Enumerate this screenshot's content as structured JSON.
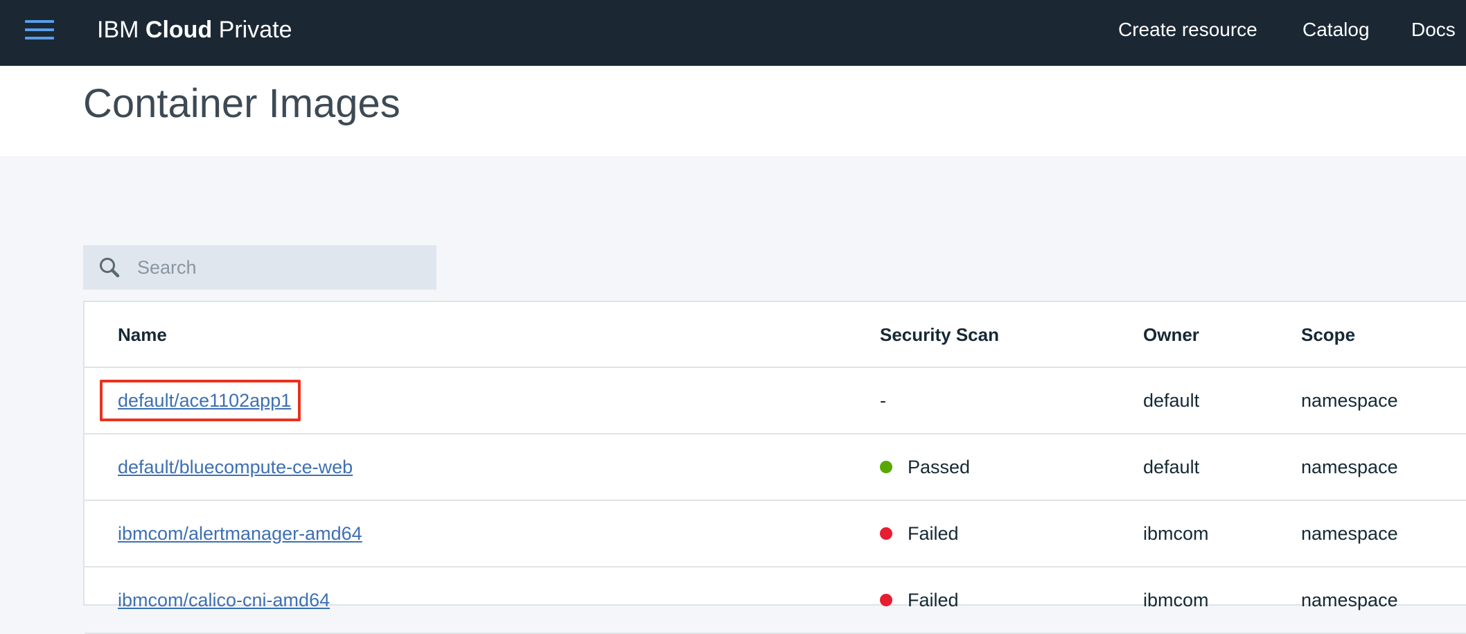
{
  "header": {
    "brand_prefix": "IBM",
    "brand_bold": "Cloud",
    "brand_suffix": "Private",
    "nav": {
      "create_resource": "Create resource",
      "catalog": "Catalog",
      "docs": "Docs"
    }
  },
  "page": {
    "title": "Container Images"
  },
  "search": {
    "placeholder": "Search",
    "value": ""
  },
  "table": {
    "columns": {
      "name": "Name",
      "security_scan": "Security Scan",
      "owner": "Owner",
      "scope": "Scope"
    },
    "rows": [
      {
        "name": "default/ace1102app1",
        "security_scan": "-",
        "owner": "default",
        "scope": "namespace"
      },
      {
        "name": "default/bluecompute-ce-web",
        "security_scan": "Passed",
        "owner": "default",
        "scope": "namespace"
      },
      {
        "name": "ibmcom/alertmanager-amd64",
        "security_scan": "Failed",
        "owner": "ibmcom",
        "scope": "namespace"
      },
      {
        "name": "ibmcom/calico-cni-amd64",
        "security_scan": "Failed",
        "owner": "ibmcom",
        "scope": "namespace"
      }
    ]
  },
  "colors": {
    "header_bg": "#1b2834",
    "accent_blue": "#5a9ee8",
    "link": "#3d70b2",
    "status_passed": "#5aa700",
    "status_failed": "#e71d32",
    "highlight": "#e8321e"
  },
  "icons": {
    "menu": "hamburger-menu-icon",
    "search": "search-icon",
    "status": "status-dot-icon"
  }
}
